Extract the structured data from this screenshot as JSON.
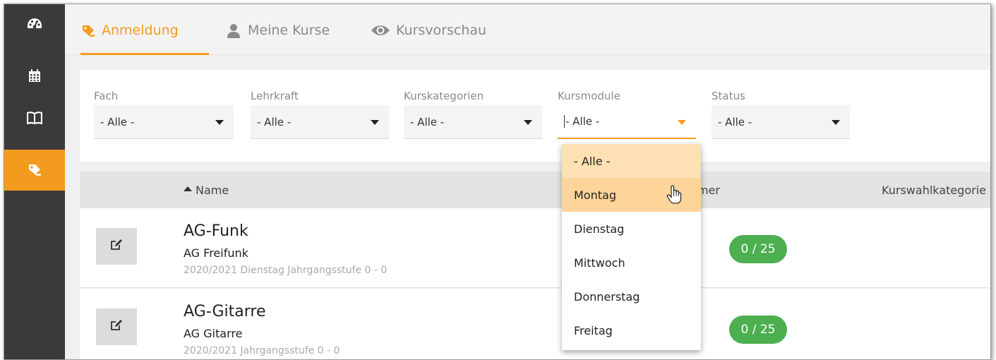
{
  "sidebar": {
    "items": [
      {
        "icon": "dashboard-icon"
      },
      {
        "icon": "calendar-icon"
      },
      {
        "icon": "book-icon"
      },
      {
        "icon": "registration-icon",
        "active": true
      }
    ]
  },
  "tabs": [
    {
      "label": "Anmeldung",
      "icon": "registration-icon",
      "active": true
    },
    {
      "label": "Meine Kurse",
      "icon": "user-icon",
      "active": false
    },
    {
      "label": "Kursvorschau",
      "icon": "eye-icon",
      "active": false
    }
  ],
  "filters": [
    {
      "label": "Fach",
      "value": "- Alle -"
    },
    {
      "label": "Lehrkraft",
      "value": "- Alle -"
    },
    {
      "label": "Kurskategorien",
      "value": "- Alle -"
    },
    {
      "label": "Kursmodule",
      "value": "- Alle -",
      "open": true
    },
    {
      "label": "Status",
      "value": "- Alle -"
    }
  ],
  "dropdown": {
    "options": [
      "- Alle -",
      "Montag",
      "Dienstag",
      "Mittwoch",
      "Donnerstag",
      "Freitag"
    ],
    "selected": "- Alle -",
    "hovered": "Montag"
  },
  "table": {
    "columns": {
      "name": "Name",
      "teilnehmer_partial": "mer",
      "kategorie": "Kurswahlkategorie"
    },
    "rows": [
      {
        "title": "AG-Funk",
        "subtitle": "AG Freifunk",
        "meta": "2020/2021  Dienstag  Jahrgangsstufe 0 - 0",
        "count": "0 / 25"
      },
      {
        "title": "AG-Gitarre",
        "subtitle": "AG Gitarre",
        "meta": "2020/2021  Jahrgangsstufe 0 - 0",
        "count": "0 / 25"
      }
    ]
  },
  "colors": {
    "accent": "#f39b1f",
    "sidebar": "#3a3a3a",
    "badge": "#4caf50",
    "dropdown_selected": "#fde0b3"
  }
}
